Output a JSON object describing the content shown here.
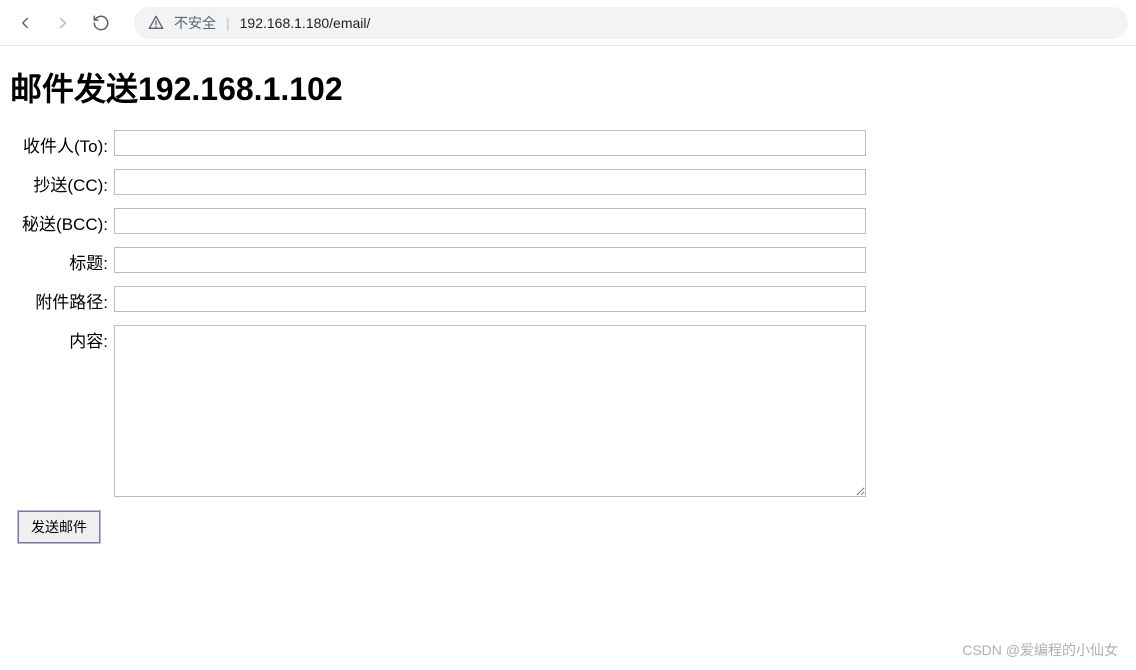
{
  "browser": {
    "security_label": "不安全",
    "url": "192.168.1.180/email/"
  },
  "page": {
    "title": "邮件发送192.168.1.102"
  },
  "form": {
    "to": {
      "label": "收件人(To):",
      "value": ""
    },
    "cc": {
      "label": "抄送(CC):",
      "value": ""
    },
    "bcc": {
      "label": "秘送(BCC):",
      "value": ""
    },
    "subject": {
      "label": "标题:",
      "value": ""
    },
    "attachment": {
      "label": "附件路径:",
      "value": ""
    },
    "body": {
      "label": "内容:",
      "value": ""
    },
    "submit_label": "发送邮件"
  },
  "watermark": "CSDN @爱编程的小仙女"
}
